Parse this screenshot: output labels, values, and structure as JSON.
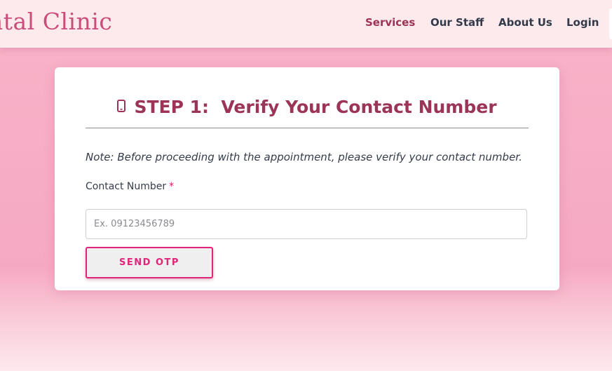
{
  "navbar": {
    "brand": "ntal Clinic",
    "links": [
      {
        "label": "Services",
        "active": true
      },
      {
        "label": "Our Staff"
      },
      {
        "label": "About Us"
      },
      {
        "label": "Login"
      }
    ]
  },
  "card": {
    "title": "STEP 1:  Verify Your Contact Number",
    "title_icon": "mobile-phone-icon",
    "note": "Note: Before proceeding with the appointment, please verify your contact number.",
    "contact_label": "Contact Number",
    "required_marker": "*",
    "contact_value": "",
    "contact_placeholder": "Ex. 09123456789",
    "send_button": "SEND OTP"
  },
  "colors": {
    "accent": "#9b3457",
    "button_accent": "#e0247a",
    "background": "#f6a9c3",
    "navbar": "#fdeaec"
  }
}
